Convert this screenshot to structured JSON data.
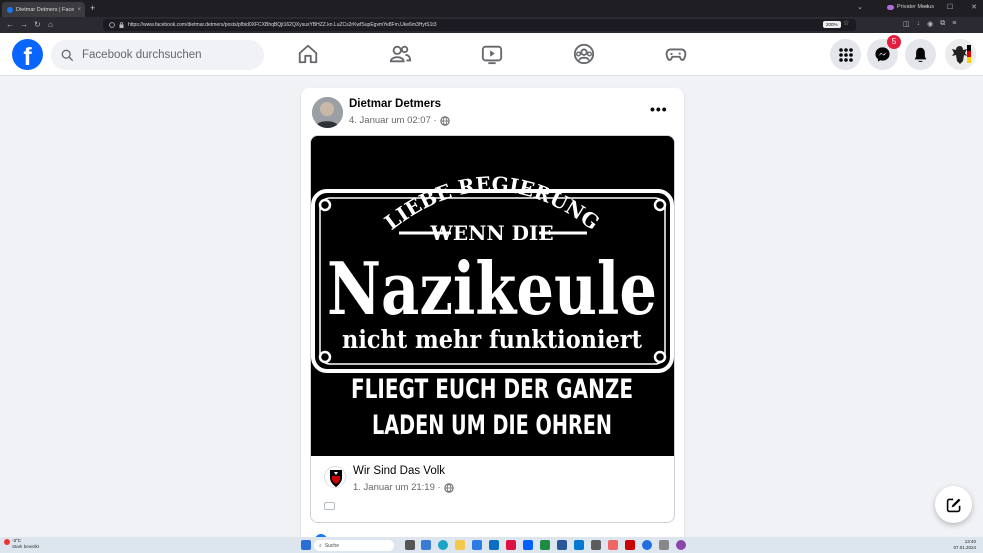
{
  "browser": {
    "tab_title": "Dietmar Detmers | Facebook",
    "tab_close": "×",
    "new_tab": "+",
    "private_label": "Privater Modus",
    "url": "https://www.facebook.com/dietmar.detmers/posts/pfbid0XFCXBhqBQjt162QXysuxYBHZZ.kn.LuZCs2rKwfSupEgvmYe8Fm.Uke6m3HytS1t3",
    "zoom": "200%",
    "window_min": "—",
    "window_max": "☐",
    "window_close": "✕"
  },
  "fb": {
    "logo": "f",
    "search_placeholder": "Facebook durchsuchen",
    "notification_count": "5"
  },
  "post": {
    "author": "Dietmar Detmers",
    "time": "4. Januar um 02:07 ·",
    "more": "•••",
    "image_text": {
      "arc": "LIEBE REGIERUNG",
      "line1": "WENN DIE",
      "big": "Nazikeule",
      "line3": "nicht mehr funktioniert",
      "bottom1": "FLIEGT EUCH DER GANZE",
      "bottom2": "LADEN UM DIE OHREN"
    },
    "shared_author": "Wir Sind Das Volk",
    "shared_time": "1. Januar um 21:19 ·"
  },
  "taskbar": {
    "weather_temp": "-3°C",
    "weather_desc": "Stark bewölkt",
    "search_label": "Suche",
    "time": "13:40",
    "date": "07.01.2024"
  },
  "colors": {
    "fb_blue": "#0866ff",
    "badge_red": "#e41e3f",
    "page_bg": "#f0f2f5"
  }
}
